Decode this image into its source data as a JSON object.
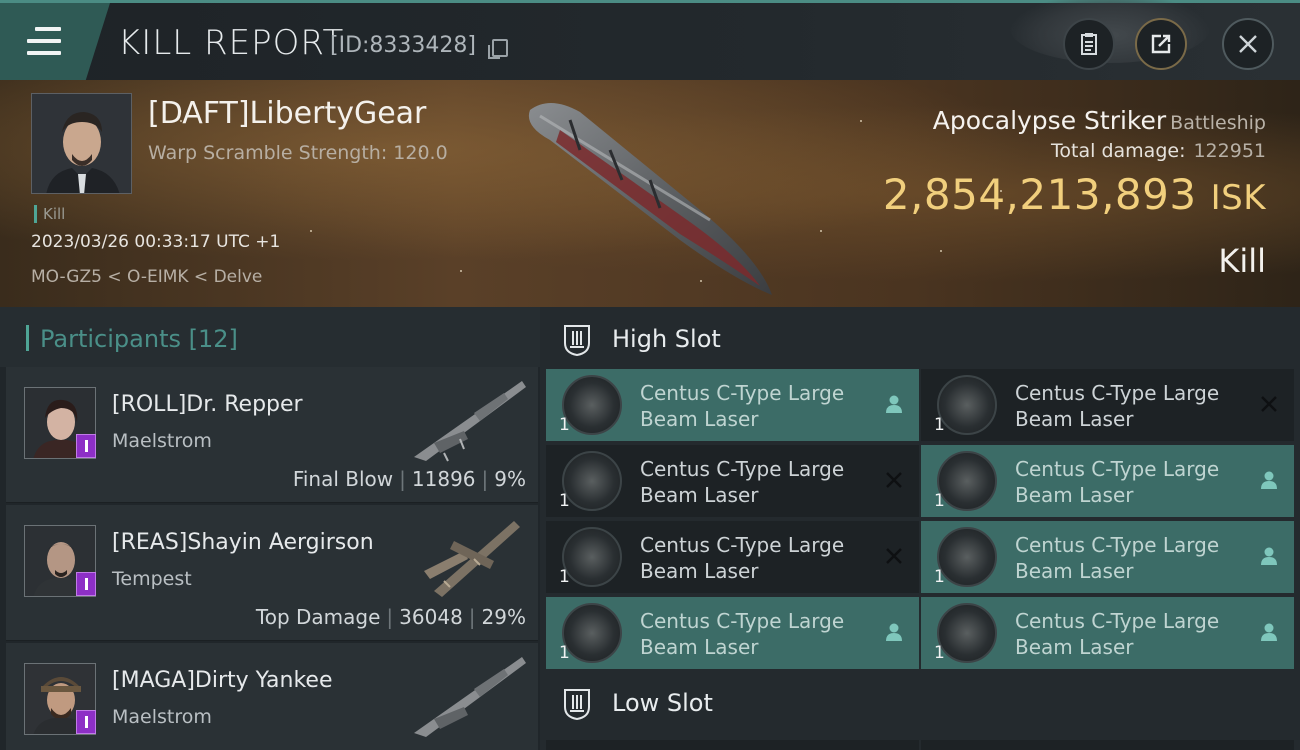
{
  "header": {
    "title": "KILL REPORT",
    "report_id": "[ID:8333428]"
  },
  "victim": {
    "name": "[DAFT]LibertyGear",
    "warp_scramble": "Warp Scramble Strength: 120.0",
    "kill_tag": "Kill",
    "datetime": "2023/03/26 00:33:17 UTC +1",
    "location": "MO-GZ5 < O-EIMK < Delve",
    "ship_name": "Apocalypse Striker",
    "ship_class": "Battleship",
    "total_damage_label": "Total damage:",
    "total_damage": "122951",
    "isk_value": "2,854,213,893",
    "isk_unit": "ISK",
    "result": "Kill"
  },
  "participants": {
    "title": "Participants",
    "count": "[12]",
    "rows": [
      {
        "name": "[ROLL]Dr. Repper",
        "ship": "Maelstrom",
        "tag": "Final Blow",
        "damage": "11896",
        "percent": "9%"
      },
      {
        "name": "[REAS]Shayin Aergirson",
        "ship": "Tempest",
        "tag": "Top Damage",
        "damage": "36048",
        "percent": "29%"
      },
      {
        "name": "[MAGA]Dirty Yankee",
        "ship": "Maelstrom",
        "tag": "",
        "damage": "",
        "percent": ""
      }
    ]
  },
  "slots": {
    "high_title": "High Slot",
    "low_title": "Low Slot",
    "high_modules": [
      {
        "line1": "Centus C-Type Large",
        "line2": "Beam Laser",
        "qty": "1",
        "state": "dropped"
      },
      {
        "line1": "Centus C-Type Large",
        "line2": "Beam Laser",
        "qty": "1",
        "state": "destroyed"
      },
      {
        "line1": "Centus C-Type Large",
        "line2": "Beam Laser",
        "qty": "1",
        "state": "destroyed"
      },
      {
        "line1": "Centus C-Type Large",
        "line2": "Beam Laser",
        "qty": "1",
        "state": "dropped"
      },
      {
        "line1": "Centus C-Type Large",
        "line2": "Beam Laser",
        "qty": "1",
        "state": "destroyed"
      },
      {
        "line1": "Centus C-Type Large",
        "line2": "Beam Laser",
        "qty": "1",
        "state": "dropped"
      },
      {
        "line1": "Centus C-Type Large",
        "line2": "Beam Laser",
        "qty": "1",
        "state": "dropped"
      },
      {
        "line1": "Centus C-Type Large",
        "line2": "Beam Laser",
        "qty": "1",
        "state": "dropped"
      }
    ]
  },
  "colors": {
    "accent": "#4fa596",
    "isk": "#f1cf7d",
    "active_module": "#3c6c67",
    "pilot_badge": "#8d2fc6"
  },
  "icons": [
    "menu-icon",
    "copy-icon",
    "clipboard-icon",
    "share-icon",
    "close-icon",
    "high-slot-icon",
    "low-slot-icon",
    "pilot-icon",
    "cross-icon"
  ]
}
